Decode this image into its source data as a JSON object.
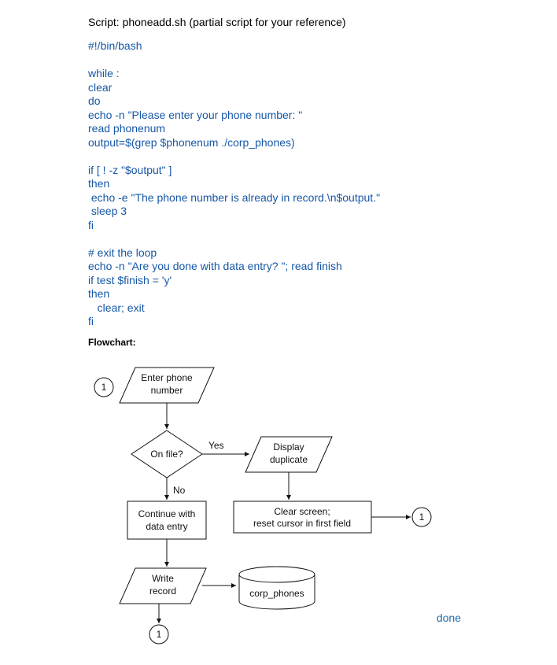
{
  "title": "Script: phoneadd.sh (partial script for your reference)",
  "code": "#!/bin/bash\n\nwhile :\nclear\ndo\necho -n \"Please enter your phone number: \"\nread phonenum\noutput=$(grep $phonenum ./corp_phones)\n\nif [ ! -z \"$output\" ]\nthen\n echo -e \"The phone number is already in record.\\n$output.\"\n sleep 3\nfi\n\n# exit the loop\necho -n \"Are you done with data entry? \"; read finish\nif test $finish = 'y'\nthen\n   clear; exit\nfi",
  "flow": {
    "label": "Flowchart:",
    "enter_l1": "Enter phone",
    "enter_l2": "number",
    "onfile": "On file?",
    "yes": "Yes",
    "no": "No",
    "display_l1": "Display",
    "display_l2": "duplicate",
    "continue_l1": "Continue with",
    "continue_l2": "data entry",
    "clear_l1": "Clear screen;",
    "clear_l2": "reset cursor in first field",
    "write_l1": "Write",
    "write_l2": "record",
    "db": "corp_phones",
    "conn": "1"
  },
  "done": "done"
}
